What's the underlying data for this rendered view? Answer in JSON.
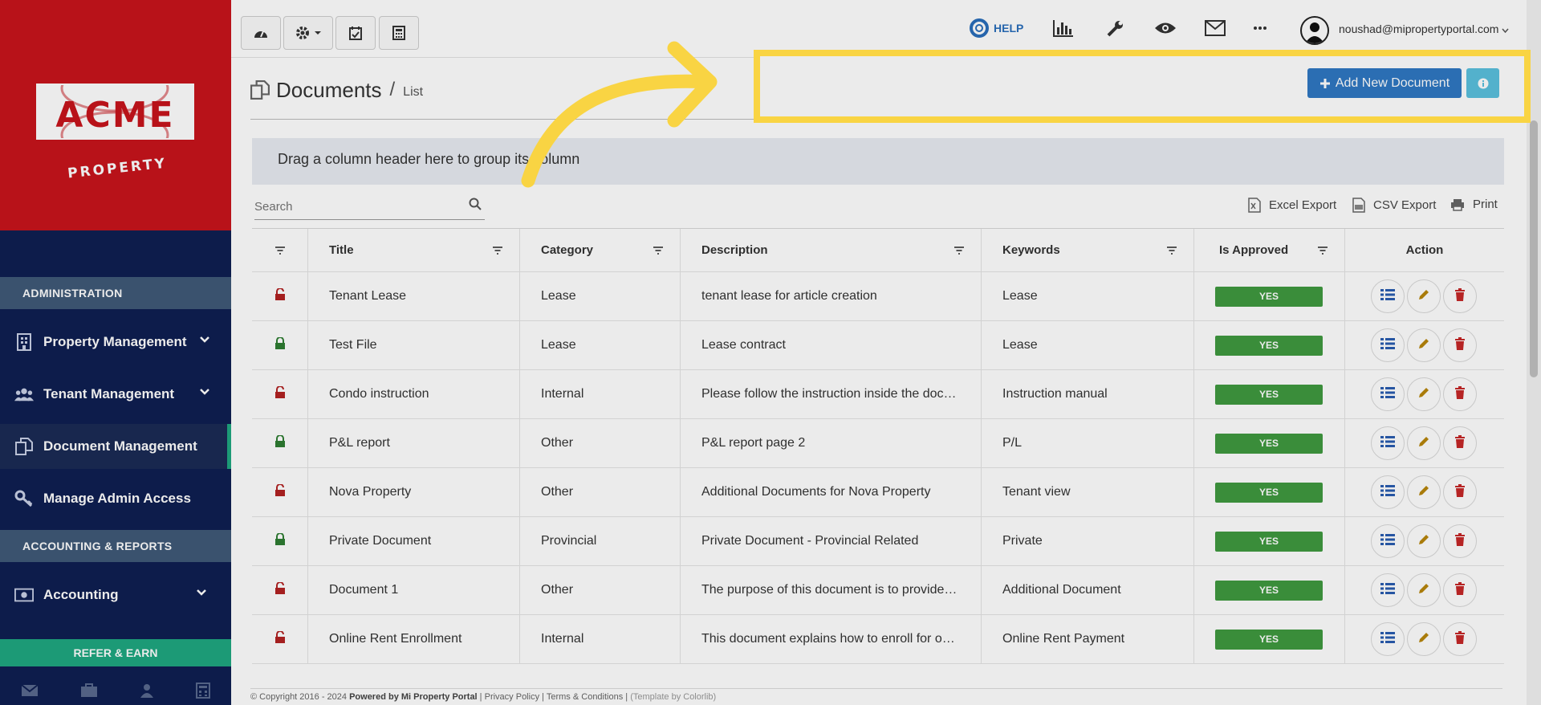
{
  "sidebar": {
    "logo_text": "ACME",
    "logo_sub": "PROPERTY",
    "section_admin": "ADMINISTRATION",
    "section_accounting": "ACCOUNTING & REPORTS",
    "items": [
      {
        "label": "Property Management",
        "icon": "building-icon"
      },
      {
        "label": "Tenant Management",
        "icon": "users-icon"
      },
      {
        "label": "Document Management",
        "icon": "documents-icon"
      },
      {
        "label": "Manage Admin Access",
        "icon": "key-icon"
      },
      {
        "label": "Accounting",
        "icon": "money-icon"
      }
    ],
    "refer_label": "REFER & EARN"
  },
  "topbar": {
    "help_label": "HELP",
    "user_email": "noushad@mipropertyportal.com"
  },
  "page": {
    "title": "Documents",
    "separator": "/",
    "crumb": "List",
    "add_button": "Add New Document"
  },
  "grid": {
    "group_hint": "Drag a column header here to group its column",
    "search_placeholder": "Search",
    "exports": [
      "Excel Export",
      "CSV Export",
      "Print"
    ],
    "columns": [
      "Title",
      "Category",
      "Description",
      "Keywords",
      "Is Approved",
      "Action"
    ],
    "rows": [
      {
        "locked": false,
        "title": "Tenant Lease",
        "category": "Lease",
        "description": "tenant lease for article creation",
        "keywords": "Lease",
        "approved": "YES"
      },
      {
        "locked": true,
        "title": "Test File",
        "category": "Lease",
        "description": "Lease contract",
        "keywords": "Lease",
        "approved": "YES"
      },
      {
        "locked": false,
        "title": "Condo instruction",
        "category": "Internal",
        "description": "Please follow the instruction inside the doc…",
        "keywords": "Instruction manual",
        "approved": "YES"
      },
      {
        "locked": true,
        "title": "P&L report",
        "category": "Other",
        "description": "P&L report page 2",
        "keywords": "P/L",
        "approved": "YES"
      },
      {
        "locked": false,
        "title": "Nova Property",
        "category": "Other",
        "description": "Additional Documents for Nova Property",
        "keywords": "Tenant view",
        "approved": "YES"
      },
      {
        "locked": true,
        "title": "Private Document",
        "category": "Provincial",
        "description": "Private Document - Provincial Related",
        "keywords": "Private",
        "approved": "YES"
      },
      {
        "locked": false,
        "title": "Document 1",
        "category": "Other",
        "description": "The purpose of this document is to provide…",
        "keywords": "Additional Document",
        "approved": "YES"
      },
      {
        "locked": false,
        "title": "Online Rent Enrollment",
        "category": "Internal",
        "description": "This document explains how to enroll for o…",
        "keywords": "Online Rent Payment",
        "approved": "YES"
      }
    ]
  },
  "footer": {
    "copyright": "© Copyright 2016 - 2024",
    "powered": "Powered by Mi Property Portal",
    "privacy": "Privacy Policy",
    "terms": "Terms & Conditions",
    "template": "(Template by Colorlib)"
  },
  "colors": {
    "sidebar_bg": "#0f1f52",
    "logo_bg": "#c8141c",
    "accent_green": "#1fa881",
    "primary_blue": "#2f78c3",
    "info_blue": "#5bc0de",
    "approved_green": "#3f9a3f",
    "highlight_yellow": "#f9d443"
  }
}
